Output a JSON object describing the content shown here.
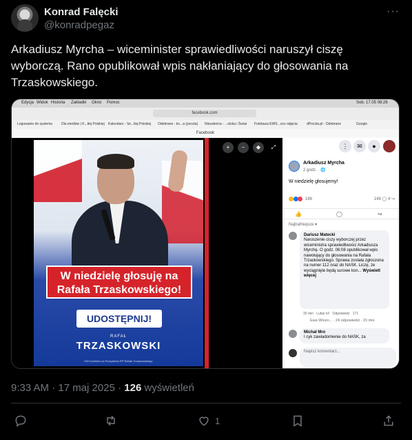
{
  "author": {
    "name": "Konrad Falęcki",
    "handle": "@konradpegaz",
    "more": "···"
  },
  "tweet": {
    "text": "Arkadiusz Myrcha – wiceminister sprawiedliwości naruszył ciszę wyborczą. Rano opublikował wpis nakłaniający do głosowania na Trzaskowskiego."
  },
  "screenshot": {
    "menubar": [
      "Edycja",
      "Widok",
      "Historia",
      "Zakładki",
      "Okno",
      "Pomoc"
    ],
    "clock": "Sob. 17.05 08:26",
    "url": "facebook.com",
    "bookmarks": [
      "Logowanie do systemu",
      "Dla mediów | K...łtej Polskiej",
      "Kalendarz - Se...łtej Polskiej",
      "Odebrane - ko...a (poczta)",
      "Niezależna - ...olska i Świat",
      "Fotobaza EWS...ces odjęcia",
      "dPoczta.pl - Odebrane",
      "Google"
    ],
    "tab_title": "Facebook",
    "poster": {
      "headline_1": "W niedzielę głosuję na",
      "headline_2": "Rafała Trzaskowskiego!",
      "share": "UDOSTĘPNIJ!",
      "rafal": "RAFAŁ",
      "surname": "TRZASKOWSKI",
      "footer": "KW Komitetu na Prezydenta RP Rafała Trzaskowskiego"
    },
    "fb_post": {
      "author": "Arkadiusz Myrcha",
      "meta": "2 godz. · 🌐",
      "text": "W niedzielę głosujemy!",
      "reactions_count": "186",
      "comments_count": "149",
      "shares_count": "4",
      "sort_label": "Najtrafniejsze ▾",
      "comment_1": {
        "author": "Dariusz Matecki",
        "text": "Naruszenie ciszy wyborczej przez wiceministra sprawiedliwości Arkadiusza Myrchę. O godz. 06:08 opublikował wpis nawołujący do głosowania na Rafała Trzaskowskiego. Sprawa została zgłoszona na numer 112 oraz do NASK. Liczę, że wyciągnięte będą surowe kon...",
        "more": "Wyświetl więcej",
        "time": "30 min",
        "like": "Lubię to!",
        "reply": "Odpowiedz",
        "likes": "171"
      },
      "replies": "Ewa Wicen... · 24 odpowiedzi · 15 min",
      "comment_2": {
        "author": "Michał Mro",
        "text": "I cyk zawiadomienie do NASK, za"
      },
      "composer_placeholder": "Napisz komentarz..."
    }
  },
  "footer": {
    "timestamp": "9:33 AM · 17 maj 2025 · ",
    "views": "126",
    "views_label": " wyświetleń",
    "likes": "1"
  },
  "colors": {
    "background": "#000000",
    "text": "#e7e9ea",
    "muted": "#71767b",
    "poster_red": "#d6232a",
    "poster_blue": "#1d3a8f"
  }
}
